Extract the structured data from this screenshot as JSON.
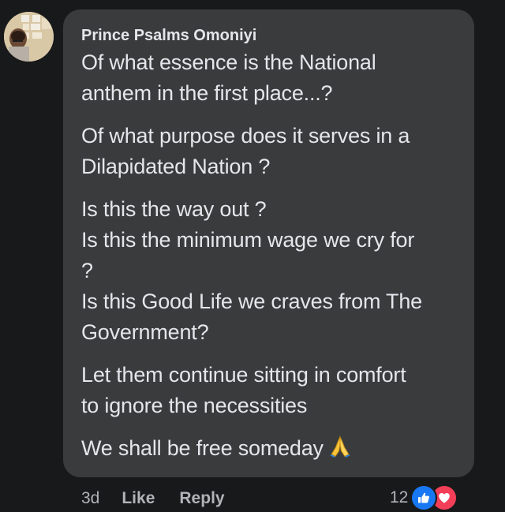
{
  "comment": {
    "author": "Prince Psalms Omoniyi",
    "paragraphs": [
      [
        "Of what essence is the National",
        "anthem in the first place...?"
      ],
      [
        "Of what purpose does it serves in a",
        "Dilapidated Nation ?"
      ],
      [
        "Is this the way out ?",
        "Is this the minimum wage we cry for",
        "?",
        "Is this Good Life we craves from The",
        "Government?"
      ],
      [
        "Let them continue sitting in comfort",
        "to ignore the necessities"
      ],
      [
        "We shall be free someday"
      ]
    ],
    "emoji": "folded-hands-icon"
  },
  "actions": {
    "time": "3d",
    "like_label": "Like",
    "reply_label": "Reply"
  },
  "reactions": {
    "count": "12",
    "types": [
      "like-icon",
      "love-icon"
    ],
    "like_color": "#1877f2",
    "love_color": "#f33e58"
  },
  "colors": {
    "background": "#18191a",
    "bubble": "#3a3b3c",
    "text": "#e4e6eb",
    "secondary_text": "#b0b3b8"
  }
}
